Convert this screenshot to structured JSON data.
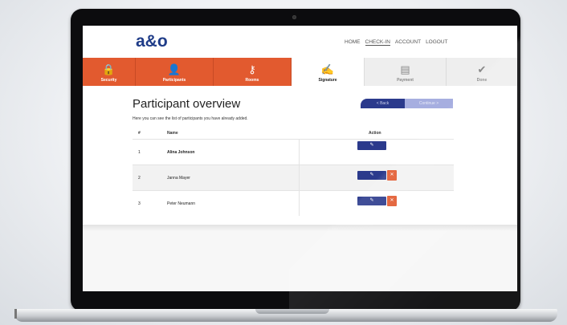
{
  "app": {
    "logo": "a&o",
    "nav": [
      {
        "label": "HOME",
        "active": false
      },
      {
        "label": "CHECK-IN",
        "active": true
      },
      {
        "label": "ACCOUNT",
        "active": false
      },
      {
        "label": "LOGOUT",
        "active": false
      }
    ]
  },
  "steps": [
    {
      "label": "Security",
      "icon": "lock-icon",
      "glyph": "🔒",
      "state": "done"
    },
    {
      "label": "Participants",
      "icon": "add-user-icon",
      "glyph": "👤",
      "state": "done"
    },
    {
      "label": "Rooms",
      "icon": "key-icon",
      "glyph": "⚷",
      "state": "done"
    },
    {
      "label": "Signature",
      "icon": "signature-icon",
      "glyph": "✍",
      "state": "current"
    },
    {
      "label": "Payment",
      "icon": "wallet-icon",
      "glyph": "▤",
      "state": "todo"
    },
    {
      "label": "Done",
      "icon": "check-circle-icon",
      "glyph": "✔",
      "state": "todo"
    }
  ],
  "page": {
    "title": "Participant overview",
    "subtitle": "Here you can see the list of participants you have already added.",
    "back_label": "< Back",
    "continue_label": "Continue >"
  },
  "table": {
    "headers": {
      "num": "#",
      "name": "Name",
      "action": "Action"
    },
    "rows": [
      {
        "num": "1",
        "name": "Alina Johnson",
        "bold": true,
        "can_delete": false
      },
      {
        "num": "2",
        "name": "Janna Mayer",
        "bold": false,
        "can_delete": true
      },
      {
        "num": "3",
        "name": "Peter Neumann",
        "bold": false,
        "can_delete": true
      }
    ],
    "edit_glyph": "✎",
    "delete_glyph": "✕"
  },
  "colors": {
    "brand_blue": "#2b3a8c",
    "accent_orange": "#e25a2f",
    "continue_disabled": "#a6aee0"
  }
}
